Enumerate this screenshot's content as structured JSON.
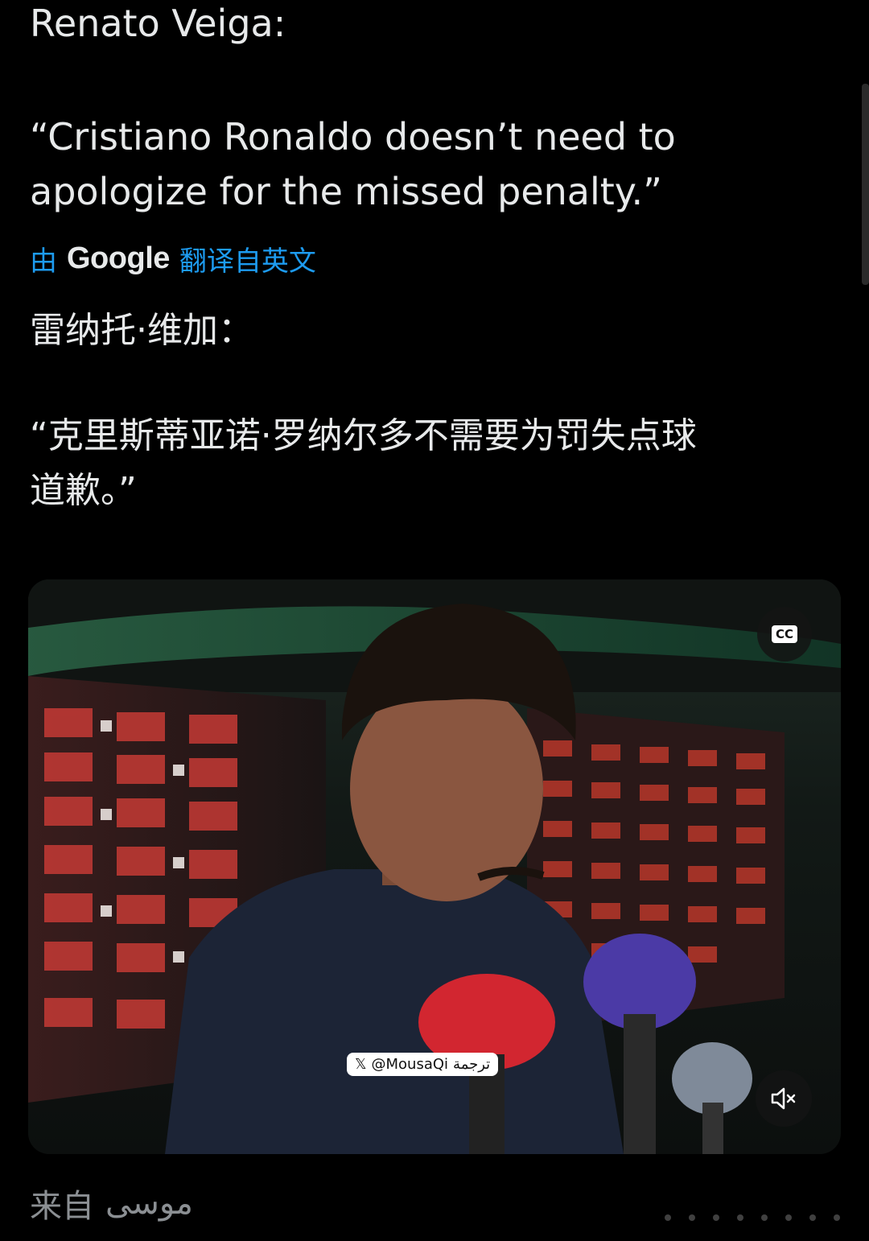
{
  "tweet": {
    "author_line": "Renato Veiga:",
    "quote_lines": [
      "“Cristiano Ronaldo doesn’t need to",
      "apologize for the missed penalty.”"
    ],
    "translation": {
      "prefix": "由",
      "brand": "Google",
      "suffix": "翻译自英文"
    },
    "author_line_zh": "雷纳托·维加：",
    "quote_lines_zh": [
      "“克里斯蒂亚诺·罗纳尔多不需要为罚失点球",
      "道歉。”"
    ]
  },
  "media": {
    "cc_label": "CC",
    "watermark_handle": "@MousaQi",
    "watermark_rtl": "ترجمة",
    "mute_icon": "muted-speaker-icon"
  },
  "footer": {
    "from_label": "来自",
    "from_user": "موسى"
  },
  "colors": {
    "background": "#000000",
    "text": "#e7e9ea",
    "link_blue": "#1d9bf0",
    "muted": "#8b8f93"
  }
}
